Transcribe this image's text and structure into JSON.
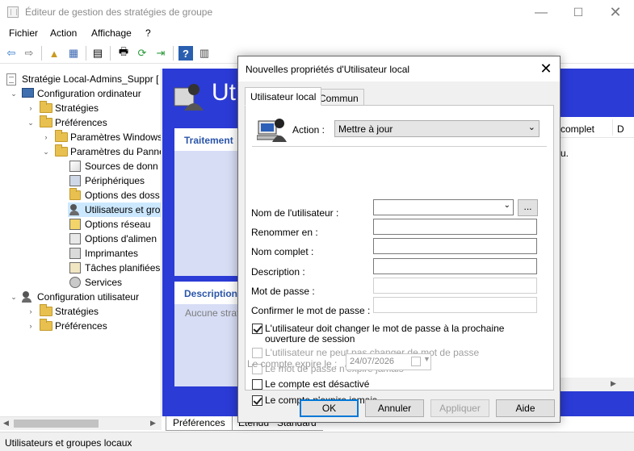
{
  "window": {
    "title": "Éditeur de gestion des stratégies de groupe",
    "min_glyph": "—",
    "max_glyph": "☐",
    "close_glyph": "✕"
  },
  "menu": [
    "Fichier",
    "Action",
    "Affichage",
    "?"
  ],
  "toolbar": {
    "icons": [
      "back-arrow-icon",
      "forward-arrow-icon",
      "up-folder-icon",
      "show-hide-tree-icon",
      "properties-icon",
      "print-icon",
      "refresh-icon",
      "export-list-icon",
      "help-icon",
      "show-action-pane-icon"
    ],
    "glyphs": [
      "⇦",
      "⇨",
      "▲",
      "▦",
      "▤",
      "🖶",
      "⟳",
      "⇥",
      "?",
      "▥"
    ]
  },
  "tree": {
    "root": "Stratégie Local-Admins_Suppr [",
    "items": [
      {
        "label": "Configuration ordinateur"
      },
      {
        "label": "Stratégies"
      },
      {
        "label": "Préférences"
      },
      {
        "label": "Paramètres Windows"
      },
      {
        "label": "Paramètres du Panne"
      },
      {
        "label": "Sources de donn"
      },
      {
        "label": "Périphériques"
      },
      {
        "label": "Options des doss"
      },
      {
        "label": "Utilisateurs et gro"
      },
      {
        "label": "Options réseau"
      },
      {
        "label": "Options d'alimen"
      },
      {
        "label": "Imprimantes"
      },
      {
        "label": "Tâches planifiées"
      },
      {
        "label": "Services"
      },
      {
        "label": "Configuration utilisateur"
      },
      {
        "label": "Stratégies"
      },
      {
        "label": "Préférences"
      }
    ],
    "expand_glyphs": {
      "open": "⌄",
      "closed": "›"
    }
  },
  "right_pane": {
    "hero_title": "Uti",
    "traitement_head": "Traitement",
    "description_head": "Description",
    "description_text": "Aucune strat",
    "col_complet": "complet",
    "col_d": "D",
    "list_text": "u."
  },
  "bottom_tabs": [
    "Préférences",
    "Étendu",
    "Standard"
  ],
  "status": "Utilisateurs et groupes locaux",
  "dialog": {
    "title": "Nouvelles propriétés d'Utilisateur local",
    "close_glyph": "✕",
    "tabs": [
      "Utilisateur local",
      "Commun"
    ],
    "action_label": "Action :",
    "action_value": "Mettre à jour",
    "fields": [
      {
        "label": "Nom de l'utilisateur :",
        "value": ""
      },
      {
        "label": "Renommer en :",
        "value": ""
      },
      {
        "label": "Nom complet :",
        "value": ""
      },
      {
        "label": "Description :",
        "value": ""
      },
      {
        "label": "Mot de passe :",
        "value": ""
      },
      {
        "label": "Confirmer le mot de passe :",
        "value": ""
      }
    ],
    "browse_label": "...",
    "checkboxes": [
      {
        "label": "L'utilisateur doit changer le mot de passe à la prochaine ouverture de session",
        "checked": true,
        "enabled": true
      },
      {
        "label": "L'utilisateur ne peut pas changer de mot de passe",
        "checked": false,
        "enabled": false
      },
      {
        "label": "Le mot de passe n'expire jamais",
        "checked": false,
        "enabled": false
      },
      {
        "label": "Le compte est désactivé",
        "checked": false,
        "enabled": true
      },
      {
        "label": "Le compte n'expire jamais",
        "checked": true,
        "enabled": true
      }
    ],
    "expire_label": "Le compte expire le :",
    "expire_date": "24/07/2026",
    "buttons": {
      "ok": "OK",
      "cancel": "Annuler",
      "apply": "Appliquer",
      "help": "Aide"
    }
  }
}
